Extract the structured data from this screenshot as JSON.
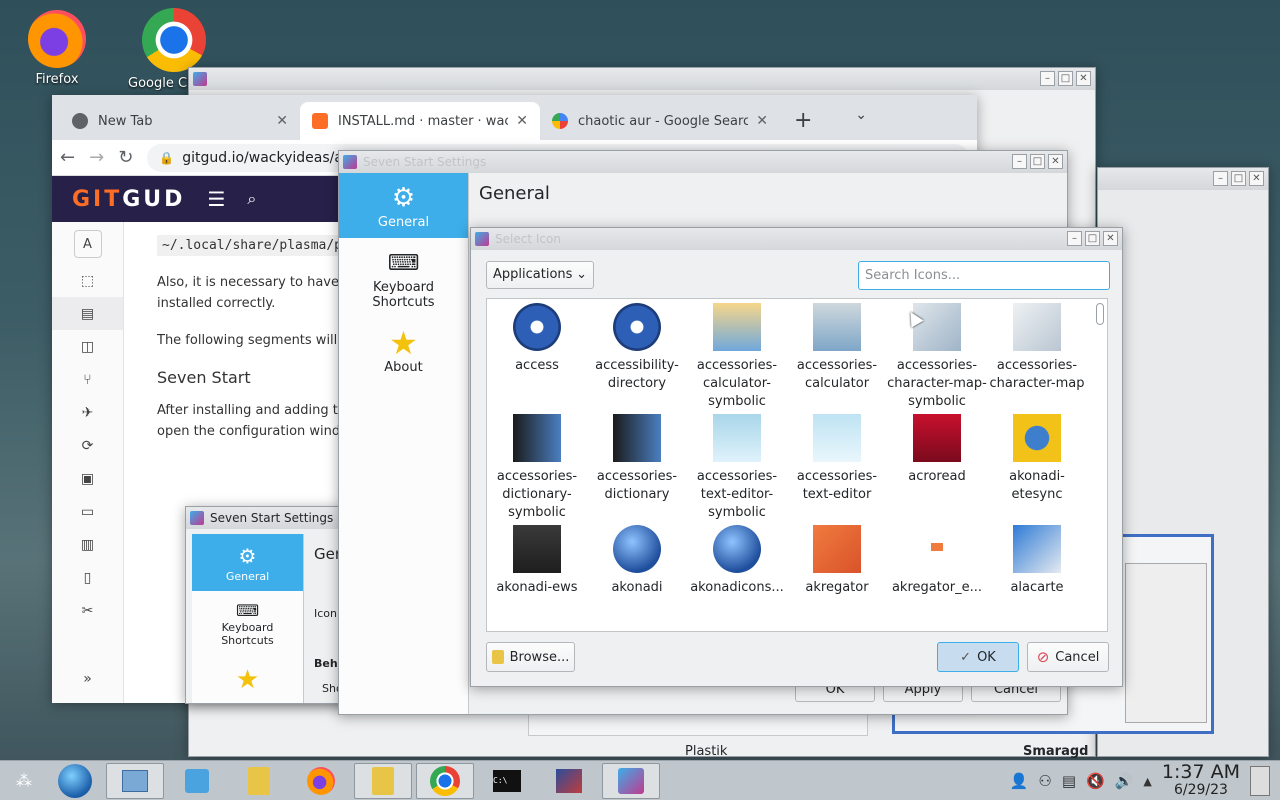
{
  "desktop": {
    "icons": [
      {
        "label": "Firefox"
      },
      {
        "label": "Google Chrome"
      }
    ]
  },
  "browser": {
    "tabs": [
      {
        "title": "New Tab"
      },
      {
        "title": "INSTALL.md · master · wackyideas / SevenStart"
      },
      {
        "title": "chaotic aur - Google Search"
      }
    ],
    "close_glyph": "✕",
    "new_tab_glyph": "+",
    "url": "gitgud.io/wackyideas/aerothemeplasma/-/blob/master/INSTALL.md",
    "site_logo_accent": "GIT",
    "site_logo_rest": "GUD",
    "avatar_letter": "A",
    "doc": {
      "code": "~/.local/share/plasma/plasmoids/",
      "p1": "Also, it is necessary to have the plasmoids installed correctly.",
      "p2": "The following segments will explain",
      "heading": "Seven Start",
      "p3": "After installing and adding the plasmoid, open the configuration window and set"
    }
  },
  "seven_small": {
    "title": "Seven Start Settings",
    "heading": "Gen",
    "general": "General",
    "keyboard": "Keyboard Shortcuts",
    "icon_label": "Icon",
    "behavior": "Beha",
    "show": "Sho"
  },
  "settings": {
    "title": "Seven Start Settings",
    "heading": "General",
    "categories": [
      {
        "label": "General"
      },
      {
        "label": "Keyboard Shortcuts"
      },
      {
        "label": "About"
      }
    ],
    "footer": {
      "ok": "OK",
      "apply": "Apply",
      "cancel": "Cancel"
    }
  },
  "dialog": {
    "title": "Select Icon",
    "combo": "Applications",
    "search_placeholder": "Search Icons...",
    "icons": [
      {
        "label": "access",
        "icon": "access-icon"
      },
      {
        "label": "accessibility-directory",
        "icon": "accessibility-icon"
      },
      {
        "label": "accessories-calculator-symbolic",
        "icon": "calculator-symbolic-icon"
      },
      {
        "label": "accessories-calculator",
        "icon": "calculator-icon"
      },
      {
        "label": "accessories-character-map-symbolic",
        "icon": "charmap-symbolic-icon"
      },
      {
        "label": "accessories-character-map",
        "icon": "charmap-icon"
      },
      {
        "label": "accessories-dictionary-symbolic",
        "icon": "dictionary-symbolic-icon"
      },
      {
        "label": "accessories-dictionary",
        "icon": "dictionary-icon"
      },
      {
        "label": "accessories-text-editor-symbolic",
        "icon": "text-editor-symbolic-icon"
      },
      {
        "label": "accessories-text-editor",
        "icon": "text-editor-icon"
      },
      {
        "label": "acroread",
        "icon": "acroread-icon"
      },
      {
        "label": "akonadi-etesync",
        "icon": "etesync-icon"
      },
      {
        "label": "akonadi-ews",
        "icon": "ews-icon"
      },
      {
        "label": "akonadi",
        "icon": "akonadi-icon"
      },
      {
        "label": "akonadicons...",
        "icon": "akonadiconsole-icon"
      },
      {
        "label": "akregator",
        "icon": "akregator-icon"
      },
      {
        "label": "akregator_e...",
        "icon": "akregator-empty-icon"
      },
      {
        "label": "alacarte",
        "icon": "alacarte-icon"
      }
    ],
    "browse": "Browse...",
    "ok": "OK",
    "cancel": "Cancel"
  },
  "background": {
    "plastik": "Plastik",
    "smaragd": "Smaragd"
  },
  "taskbar": {
    "clock_time": "1:37 AM",
    "clock_date": "6/29/23"
  },
  "colors": {
    "accent": "#3daee9",
    "selection": "#3daee9",
    "gitgud_bar": "#27214a"
  }
}
